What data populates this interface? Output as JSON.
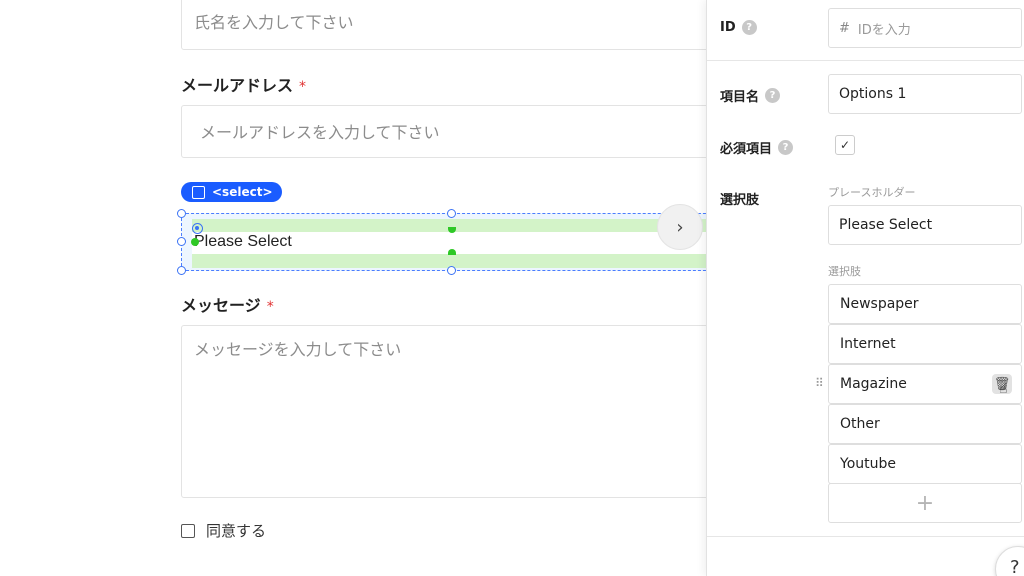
{
  "canvas": {
    "name_field": {
      "placeholder": "氏名を入力して下さい"
    },
    "email_field": {
      "label": "メールアドレス",
      "required_mark": "*",
      "placeholder": "メールアドレスを入力して下さい"
    },
    "select_field": {
      "tag": "<select>",
      "value": "Please Select"
    },
    "message_field": {
      "label": "メッセージ",
      "required_mark": "*",
      "placeholder": "メッセージを入力して下さい"
    },
    "agree_checkbox": {
      "label": "同意する",
      "checked": false
    },
    "next_button": {
      "icon": "chevron-right-icon",
      "glyph": "›"
    }
  },
  "panel": {
    "id_row": {
      "label": "ID",
      "prefix": "#",
      "placeholder": "IDを入力"
    },
    "item_name_row": {
      "label": "項目名",
      "value": "Options 1"
    },
    "required_row": {
      "label": "必須項目",
      "checked": true,
      "glyph": "✓"
    },
    "choices_row": {
      "label": "選択肢",
      "placeholder_label": "プレースホルダー",
      "placeholder_value": "Please Select",
      "options_label": "選択肢",
      "options": [
        "Newspaper",
        "Internet",
        "Magazine",
        "Other",
        "Youtube"
      ],
      "add_glyph": "+"
    },
    "help_glyph": "?",
    "help_fab_glyph": "?"
  },
  "colors": {
    "accent": "#1a5cff",
    "selection_green": "#d3f3c8",
    "required": "#e03131"
  }
}
